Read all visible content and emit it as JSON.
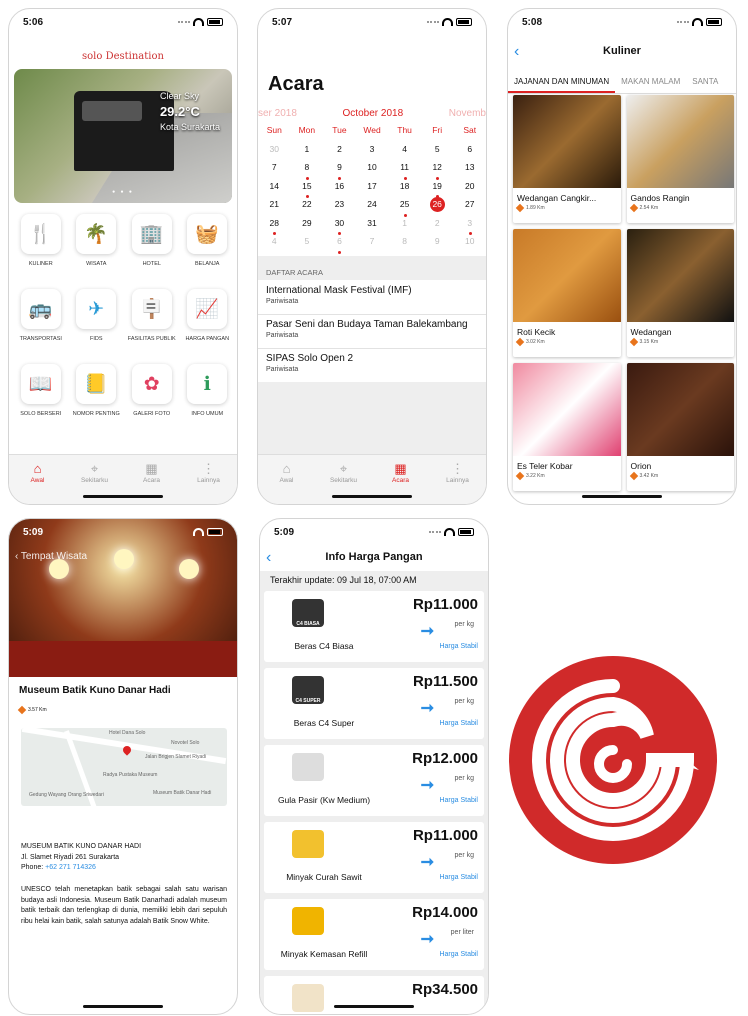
{
  "accent": "#d42222",
  "p1": {
    "time": "5:06",
    "brand": "solo Destination",
    "weather": "Clear Sky",
    "temp": "29.2°C",
    "city": "Kota Surakarta",
    "menu": [
      {
        "icon": "cutlery-icon",
        "glyph": "🍴",
        "label": "KULINER"
      },
      {
        "icon": "palm-tree-icon",
        "glyph": "🌴",
        "label": "WISATA"
      },
      {
        "icon": "building-icon",
        "glyph": "🏢",
        "label": "HOTEL"
      },
      {
        "icon": "basket-icon",
        "glyph": "🧺",
        "label": "BELANJA"
      },
      {
        "icon": "bus-icon",
        "glyph": "🚌",
        "label": "TRANSPORTASI"
      },
      {
        "icon": "plane-icon",
        "glyph": "✈",
        "label": "FIDS"
      },
      {
        "icon": "signpost-icon",
        "glyph": "🪧",
        "label": "FASILITAS PUBLIK"
      },
      {
        "icon": "chart-icon",
        "glyph": "📈",
        "label": "HARGA PANGAN"
      },
      {
        "icon": "book-icon",
        "glyph": "📖",
        "label": "SOLO BERSERI"
      },
      {
        "icon": "phone-book-icon",
        "glyph": "📒",
        "label": "NOMOR PENTING"
      },
      {
        "icon": "flower-icon",
        "glyph": "✿",
        "label": "GALERI FOTO"
      },
      {
        "icon": "info-icon",
        "glyph": "ℹ",
        "label": "INFO UMUM"
      }
    ]
  },
  "tabs": [
    "Awal",
    "Sekitarku",
    "Acara",
    "Lainnya"
  ],
  "p2": {
    "time": "5:07",
    "title": "Acara",
    "prev": "ser 2018",
    "month": "October 2018",
    "next": "Novemb",
    "days": [
      "Sun",
      "Mon",
      "Tue",
      "Wed",
      "Thu",
      "Fri",
      "Sat"
    ],
    "section": "DAFTAR ACARA",
    "events": [
      {
        "title": "International Mask Festival (IMF)",
        "cat": "Pariwisata"
      },
      {
        "title": "Pasar Seni dan Budaya Taman Balekambang",
        "cat": "Pariwisata"
      },
      {
        "title": "SIPAS Solo Open 2",
        "cat": "Pariwisata"
      }
    ]
  },
  "p3": {
    "time": "5:08",
    "title": "Kuliner",
    "tabs": [
      "JAJANAN DAN MINUMAN",
      "MAKAN MALAM",
      "SANTA"
    ],
    "items": [
      {
        "name": "Wedangan Cangkir...",
        "km": "1.89 Km"
      },
      {
        "name": "Gandos Rangin",
        "km": "2.54 Km"
      },
      {
        "name": "Roti Kecik",
        "km": "3.02 Km"
      },
      {
        "name": "Wedangan",
        "km": "3.15 Km"
      },
      {
        "name": "Es Teler Kobar",
        "km": "3.22 Km"
      },
      {
        "name": "Orion",
        "km": "3.42 Km"
      }
    ]
  },
  "p4": {
    "time": "5:09",
    "back": "‹ Tempat Wisata",
    "title": "Museum Batik Kuno Danar Hadi",
    "km": "3.57 Km",
    "map": {
      "l1": "Hotel Dana Solo",
      "l2": "Jalan Brigjen Slamet Riyadi",
      "l3": "Novotel Solo",
      "l4": "Radya Pustaka Museum",
      "l5": "Museum Batik Danar Hadi",
      "l6": "Gedung Wayang Orang Sriwedari"
    },
    "addr1": "MUSEUM BATIK KUNO DANAR HADI",
    "addr2": "Jl. Slamet Riyadi 261 Surakarta",
    "phoneLabel": "Phone:",
    "phone": "+62 271 714326",
    "desc": "UNESCO telah menetapkan batik sebagai salah satu warisan budaya asli Indonesia. Museum Batik Danarhadi adalah museum batik terbaik dan terlengkap di dunia, memiliki lebih dari sepuluh ribu helai kain batik, salah satunya adalah Batik Snow White."
  },
  "p5": {
    "time": "5:09",
    "title": "Info Harga Pangan",
    "update": "Terakhir update: 09 Jul 18, 07:00 AM",
    "items": [
      {
        "name": "Beras C4 Biasa",
        "price": "Rp11.000",
        "unit": "per kg",
        "status": "Harga Stabil",
        "tag": "C4 BIASA",
        "color": "#333"
      },
      {
        "name": "Beras C4 Super",
        "price": "Rp11.500",
        "unit": "per kg",
        "status": "Harga Stabil",
        "tag": "C4 SUPER",
        "color": "#333"
      },
      {
        "name": "Gula Pasir (Kw Medium)",
        "price": "Rp12.000",
        "unit": "per kg",
        "status": "Harga Stabil",
        "tag": "",
        "color": "#ddd"
      },
      {
        "name": "Minyak Curah Sawit",
        "price": "Rp11.000",
        "unit": "per kg",
        "status": "Harga Stabil",
        "tag": "",
        "color": "#f2c12e"
      },
      {
        "name": "Minyak Kemasan Refill",
        "price": "Rp14.000",
        "unit": "per liter",
        "status": "Harga Stabil",
        "tag": "",
        "color": "#f0b400"
      },
      {
        "name": "",
        "price": "Rp34.500",
        "unit": "",
        "status": "",
        "tag": "",
        "color": "#f1e3c8"
      }
    ]
  }
}
